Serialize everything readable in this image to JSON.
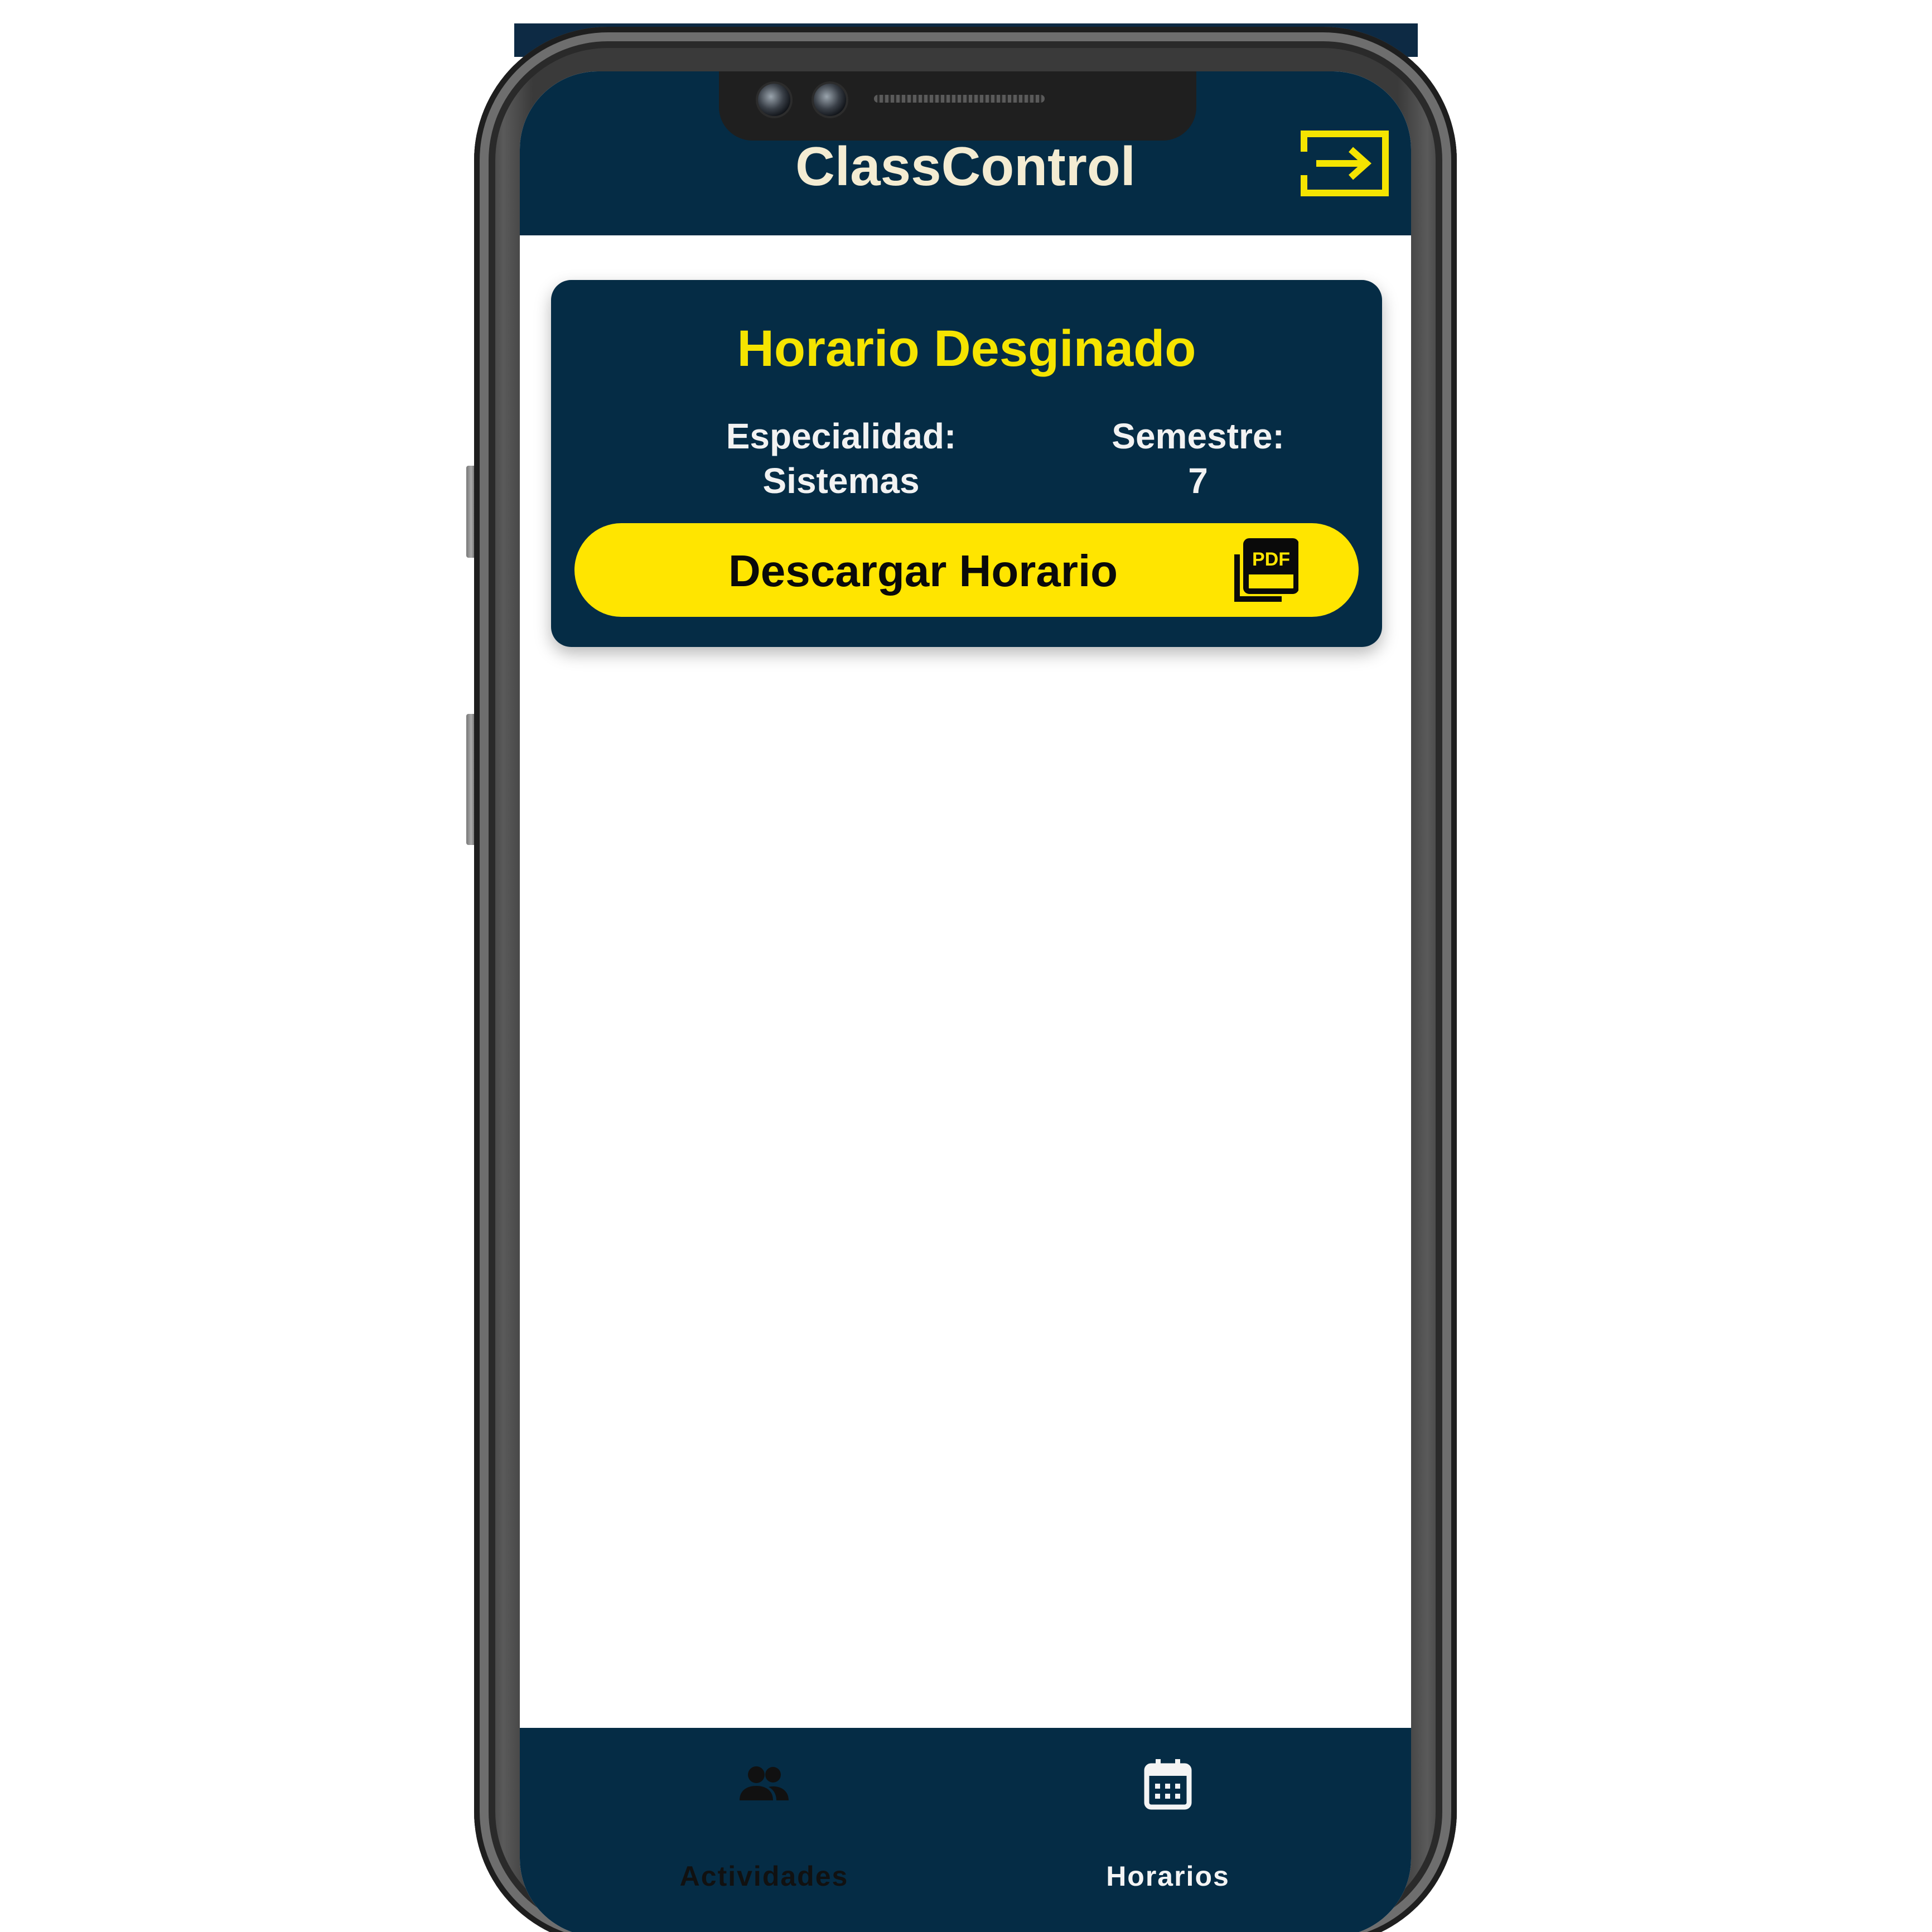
{
  "app": {
    "title": "ClassControl"
  },
  "header": {
    "logout_icon": "logout-arrow-icon"
  },
  "card": {
    "title": "Horario Desginado",
    "especialidad_label": "Especialidad:",
    "especialidad_value": "Sistemas",
    "semestre_label": "Semestre:",
    "semestre_value": "7",
    "download_button_label": "Descargar Horario",
    "download_icon": "pdf-icon"
  },
  "bottom_nav": {
    "items": [
      {
        "label": "Actividades",
        "icon": "people-icon",
        "selected": false
      },
      {
        "label": "Horarios",
        "icon": "calendar-icon",
        "selected": true
      }
    ]
  },
  "colors": {
    "primary": "#052c45",
    "accent": "#ffe500",
    "title_text": "#f4ecd2",
    "background": "#ffffff"
  }
}
